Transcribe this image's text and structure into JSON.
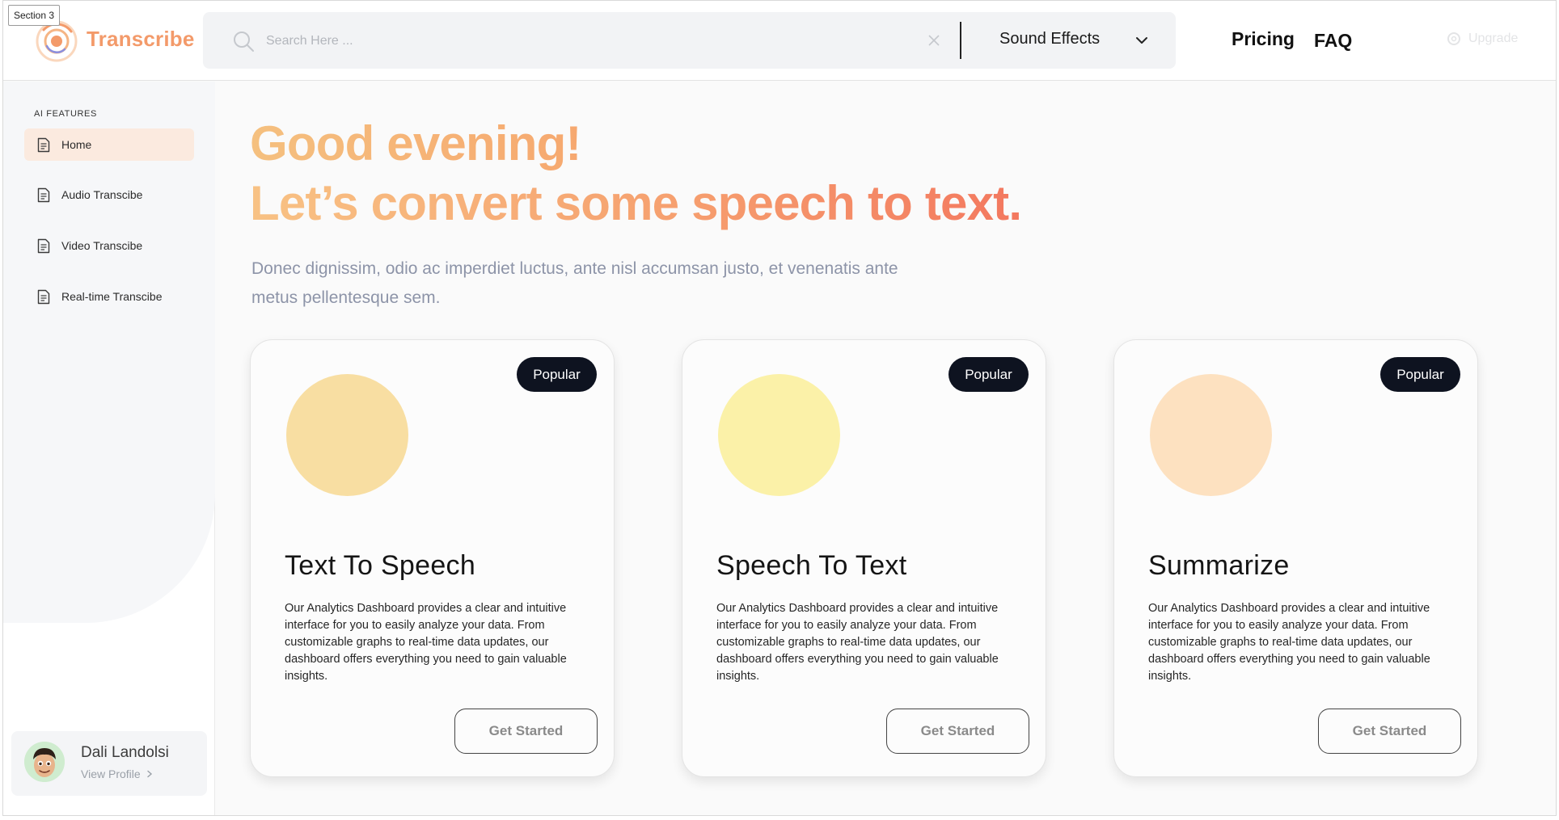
{
  "section_tag": "Section 3",
  "header": {
    "brand": "Transcribe",
    "search": {
      "placeholder": "Search Here ...",
      "value": ""
    },
    "category": "Sound Effects",
    "nav": {
      "pricing": "Pricing",
      "faq": "FAQ"
    },
    "upgrade": "Upgrade"
  },
  "sidebar": {
    "heading": "AI FEATURES",
    "items": [
      {
        "label": "Home",
        "active": true
      },
      {
        "label": "Audio Transcibe",
        "active": false
      },
      {
        "label": "Video Transcibe",
        "active": false
      },
      {
        "label": "Real-time Transcibe",
        "active": false
      }
    ],
    "profile": {
      "name": "Dali Landolsi",
      "link": "View Profile"
    }
  },
  "main": {
    "greeting_line1": "Good evening!",
    "greeting_line2": "Let’s convert some speech to text.",
    "subtitle": "Donec dignissim, odio ac imperdiet luctus, ante nisl accumsan justo, et venenatis ante metus pellentesque sem.",
    "cards": [
      {
        "badge": "Popular",
        "title": "Text To Speech",
        "description": "Our Analytics Dashboard provides a clear and intuitive interface for you to easily analyze your data. From customizable graphs to real-time data updates, our dashboard offers everything you need to gain valuable insights.",
        "button": "Get Started",
        "circle_color": "#f8dea2"
      },
      {
        "badge": "Popular",
        "title": "Speech To Text",
        "description": "Our Analytics Dashboard provides a clear and intuitive interface for you to easily analyze your data. From customizable graphs to real-time data updates, our dashboard offers everything you need to gain valuable insights.",
        "button": "Get Started",
        "circle_color": "#fbf1a8"
      },
      {
        "badge": "Popular",
        "title": "Summarize",
        "description": "Our Analytics Dashboard provides a clear and intuitive interface for you to easily analyze your data. From customizable graphs to real-time data updates, our dashboard offers everything you need to gain valuable insights.",
        "button": "Get Started",
        "circle_color": "#fde1c0"
      }
    ]
  },
  "colors": {
    "brand": "#f39a6a",
    "active_nav_bg": "#fbeadf",
    "badge_bg": "#0e1320"
  }
}
